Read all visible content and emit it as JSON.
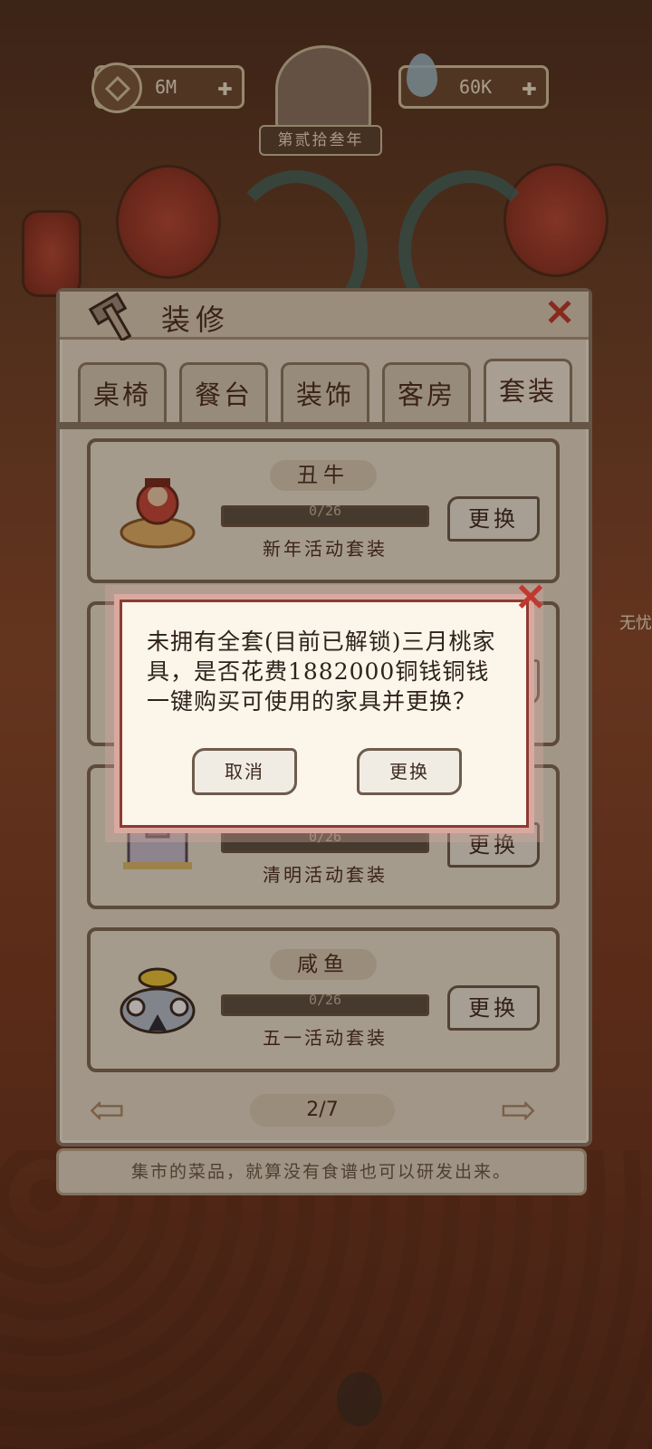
{
  "resources": {
    "coins": "6M",
    "coins_plus": "✚",
    "water": "60K",
    "water_plus": "✚",
    "year": "第贰拾叁年"
  },
  "panel": {
    "title": "装修",
    "close": "✕",
    "tabs": [
      {
        "label": "桌椅"
      },
      {
        "label": "餐台"
      },
      {
        "label": "装饰"
      },
      {
        "label": "客房"
      },
      {
        "label": "套装"
      }
    ],
    "active_tab": "套装",
    "sets": [
      {
        "name": "丑牛",
        "progress": "0/26",
        "progress_fraction": 0,
        "desc": "新年活动套装",
        "button": "更换"
      },
      {
        "name": "",
        "progress": "",
        "progress_fraction": 0,
        "desc": "",
        "button": ""
      },
      {
        "name": "",
        "progress": "0/26",
        "progress_fraction": 0,
        "desc": "清明活动套装",
        "button": "更换"
      },
      {
        "name": "咸鱼",
        "progress": "0/26",
        "progress_fraction": 0,
        "desc": "五一活动套装",
        "button": "更换"
      }
    ],
    "pager": {
      "page": "2/7",
      "prev": "⇦",
      "next": "⇨"
    }
  },
  "tip": "集市的菜品，就算没有食谱也可以研发出来。",
  "side_label": "无忧",
  "dialog": {
    "message": "未拥有全套(目前已解锁)三月桃家具，是否花费1882000铜钱铜钱一键购买可使用的家具并更换？",
    "cancel": "取消",
    "confirm": "更换",
    "close": "✕"
  },
  "colors": {
    "accent_red": "#c2382f",
    "panel_bg": "#e9dfcd",
    "dialog_border": "#d9a9a0"
  }
}
